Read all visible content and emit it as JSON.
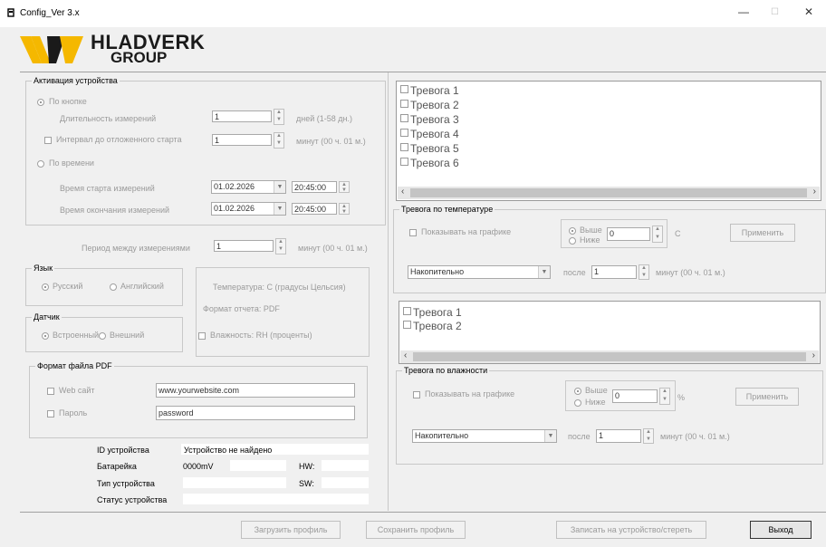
{
  "window": {
    "title": "Config_Ver 3.x",
    "min": "—",
    "max": "☐",
    "close": "✕"
  },
  "logo": {
    "line1": "HLADVERK",
    "line2": "GROUP"
  },
  "activation": {
    "legend": "Активация устройства",
    "by_button": "По кнопке",
    "duration_label": "Длительность измерений",
    "duration_value": "1",
    "duration_unit": "дней (1-58 дн.)",
    "delay_label": "Интервал до отложенного старта",
    "delay_value": "1",
    "delay_unit": "минут (00 ч. 01 м.)",
    "by_time": "По времени",
    "start_label": "Время старта измерений",
    "start_date": "01.02.2026",
    "start_time": "20:45:00",
    "end_label": "Время окончания измерений",
    "end_date": "01.02.2026",
    "end_time": "20:45:00"
  },
  "period": {
    "label": "Период между измерениями",
    "value": "1",
    "unit": "минут (00 ч. 01 м.)"
  },
  "language": {
    "legend": "Язык",
    "ru": "Русский",
    "en": "Английский"
  },
  "units": {
    "temp": "Температура: C (градусы Цельсия)",
    "report": "Формат отчета: PDF",
    "humidity": "Влажность: RH (проценты)"
  },
  "sensor": {
    "legend": "Датчик",
    "internal": "Встроенный",
    "external": "Внешний"
  },
  "pdf": {
    "legend": "Формат файла PDF",
    "web_label": "Web сайт",
    "web_value": "www.yourwebsite.com",
    "pass_label": "Пароль",
    "pass_value": "password"
  },
  "info": {
    "id_label": "ID устройства",
    "id_value": "Устройство не найдено",
    "bat_label": "Батарейка",
    "bat_value": "0000mV",
    "hw_label": "HW:",
    "type_label": "Тип устройства",
    "sw_label": "SW:",
    "status_label": "Статус устройства"
  },
  "temp_alarms": {
    "items": [
      "Тревога 1",
      "Тревога 2",
      "Тревога 3",
      "Тревога 4",
      "Тревога 5",
      "Тревога 6"
    ],
    "legend": "Тревога по температуре",
    "show_on_chart": "Показывать на графике",
    "above": "Выше",
    "below": "Ниже",
    "value": "0",
    "unit": "C",
    "apply": "Применить",
    "mode": "Накопительно",
    "after": "после",
    "after_value": "1",
    "after_unit": "минут (00 ч. 01 м.)"
  },
  "hum_alarms": {
    "items": [
      "Тревога 1",
      "Тревога 2"
    ],
    "legend": "Тревога по влажности",
    "show_on_chart": "Показывать на графике",
    "above": "Выше",
    "below": "Ниже",
    "value": "0",
    "unit": "%",
    "apply": "Применить",
    "mode": "Накопительно",
    "after": "после",
    "after_value": "1",
    "after_unit": "минут (00 ч. 01 м.)"
  },
  "buttons": {
    "load": "Загрузить профиль",
    "save": "Сохранить профиль",
    "write": "Записать на устройство/стереть",
    "exit": "Выход"
  },
  "colors": {
    "logo_yellow": "#f5b800",
    "logo_dark": "#1a1a1a"
  }
}
